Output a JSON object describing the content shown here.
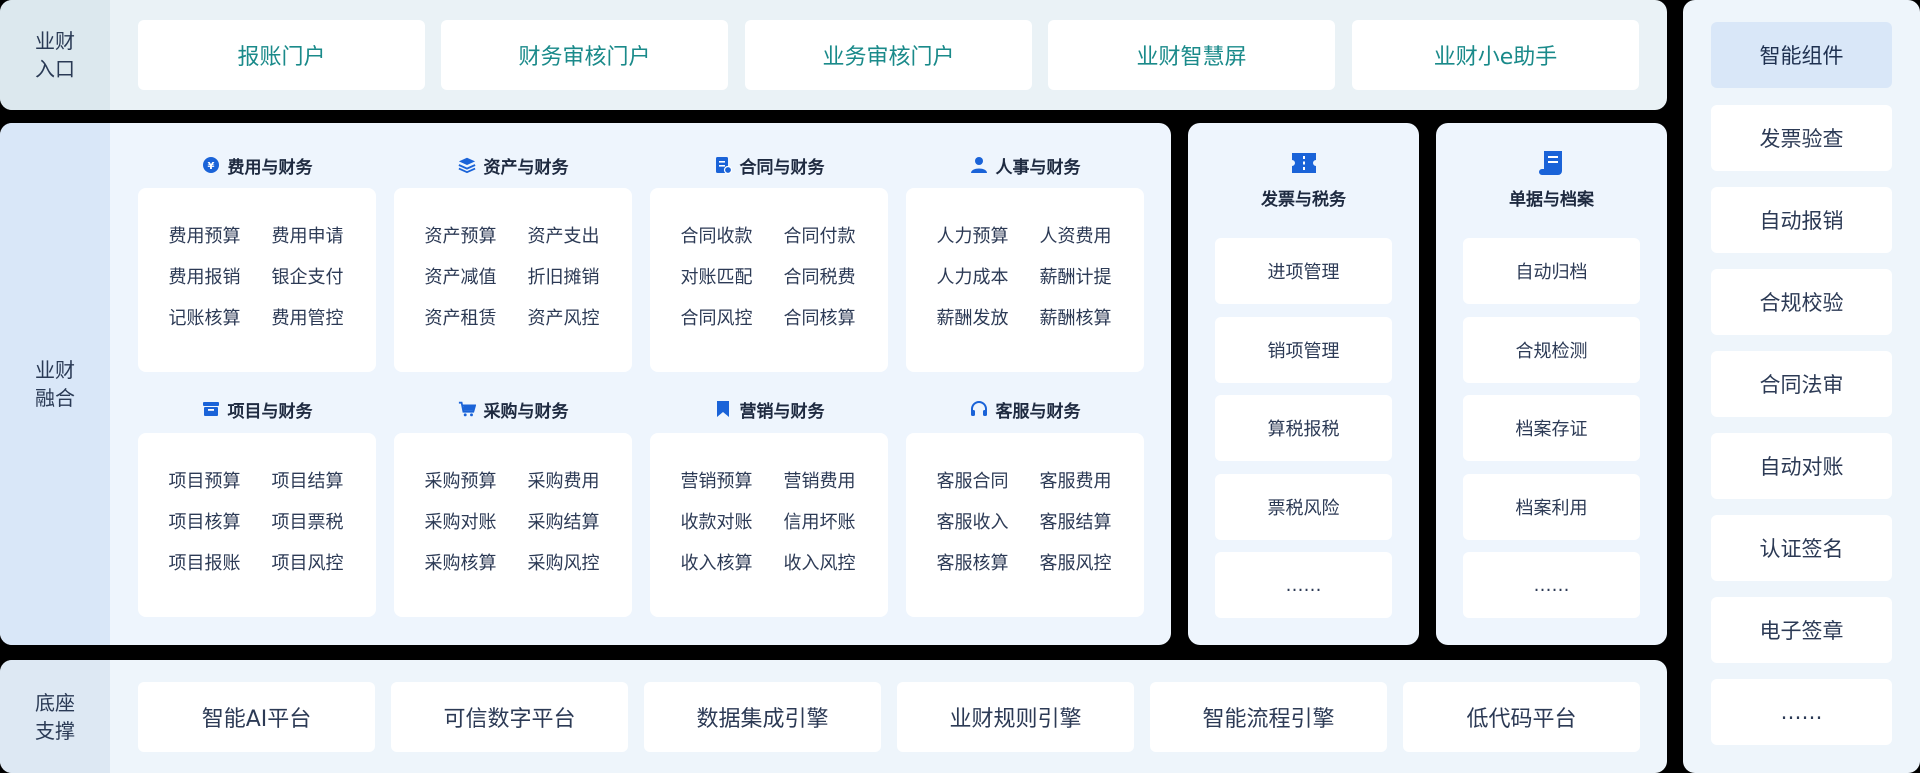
{
  "entry": {
    "label": [
      "业财",
      "入口"
    ],
    "buttons": [
      "报账门户",
      "财务审核门户",
      "业务审核门户",
      "业财智慧屏",
      "业财小e助手"
    ]
  },
  "fusion": {
    "label": [
      "业财",
      "融合"
    ],
    "categories": [
      {
        "title": "费用与财务",
        "icon": "coin-icon",
        "items": [
          "费用预算",
          "费用申请",
          "费用报销",
          "银企支付",
          "记账核算",
          "费用管控"
        ]
      },
      {
        "title": "资产与财务",
        "icon": "layers-icon",
        "items": [
          "资产预算",
          "资产支出",
          "资产减值",
          "折旧摊销",
          "资产租赁",
          "资产风控"
        ]
      },
      {
        "title": "合同与财务",
        "icon": "contract-icon",
        "items": [
          "合同收款",
          "合同付款",
          "对账匹配",
          "合同税费",
          "合同风控",
          "合同核算"
        ]
      },
      {
        "title": "人事与财务",
        "icon": "person-icon",
        "items": [
          "人力预算",
          "人资费用",
          "人力成本",
          "薪酬计提",
          "薪酬发放",
          "薪酬核算"
        ]
      },
      {
        "title": "项目与财务",
        "icon": "archive-box-icon",
        "items": [
          "项目预算",
          "项目结算",
          "项目核算",
          "项目票税",
          "项目报账",
          "项目风控"
        ]
      },
      {
        "title": "采购与财务",
        "icon": "cart-icon",
        "items": [
          "采购预算",
          "采购费用",
          "采购对账",
          "采购结算",
          "采购核算",
          "采购风控"
        ]
      },
      {
        "title": "营销与财务",
        "icon": "bookmark-icon",
        "items": [
          "营销预算",
          "营销费用",
          "收款对账",
          "信用坏账",
          "收入核算",
          "收入风控"
        ]
      },
      {
        "title": "客服与财务",
        "icon": "headset-icon",
        "items": [
          "客服合同",
          "客服费用",
          "客服收入",
          "客服结算",
          "客服核算",
          "客服风控"
        ]
      }
    ]
  },
  "invoice": {
    "title": "发票与税务",
    "icon": "ticket-icon",
    "items": [
      "进项管理",
      "销项管理",
      "算税报税",
      "票税风险",
      "……"
    ]
  },
  "archive": {
    "title": "单据与档案",
    "icon": "scroll-icon",
    "items": [
      "自动归档",
      "合规检测",
      "档案存证",
      "档案利用",
      "……"
    ]
  },
  "base": {
    "label": [
      "底座",
      "支撑"
    ],
    "buttons": [
      "智能AI平台",
      "可信数字平台",
      "数据集成引擎",
      "业财规则引擎",
      "智能流程引擎",
      "低代码平台"
    ]
  },
  "smart": {
    "title": "智能组件",
    "items": [
      "发票验查",
      "自动报销",
      "合规校验",
      "合同法审",
      "自动对账",
      "认证签名",
      "电子签章",
      "……"
    ]
  },
  "colors": {
    "entry_text": "#1a8a8a",
    "icon_blue": "#1a63d8",
    "panel_bg": "#eef5fd"
  }
}
